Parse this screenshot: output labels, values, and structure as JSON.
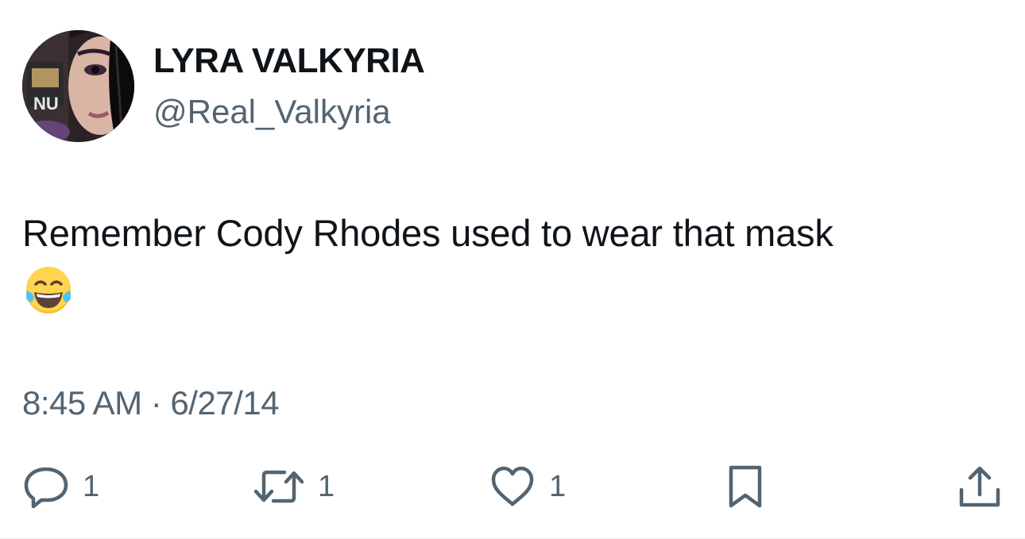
{
  "author": {
    "display_name": "LYRA VALKYRIA",
    "handle": "@Real_Valkyria",
    "avatar_icon": "profile-photo",
    "avatar_logo_text": "NU"
  },
  "tweet": {
    "text": "Remember Cody Rhodes used to wear that mask",
    "emoji": "face-with-tears-of-joy",
    "timestamp": "8:45 AM · 6/27/14"
  },
  "actions": {
    "reply_count": "1",
    "retweet_count": "1",
    "like_count": "1",
    "reply_icon": "reply-icon",
    "retweet_icon": "retweet-icon",
    "like_icon": "heart-icon",
    "bookmark_icon": "bookmark-icon",
    "share_icon": "share-icon"
  },
  "colors": {
    "primary_text": "#0f1419",
    "secondary_text": "#536471",
    "background": "#ffffff"
  }
}
